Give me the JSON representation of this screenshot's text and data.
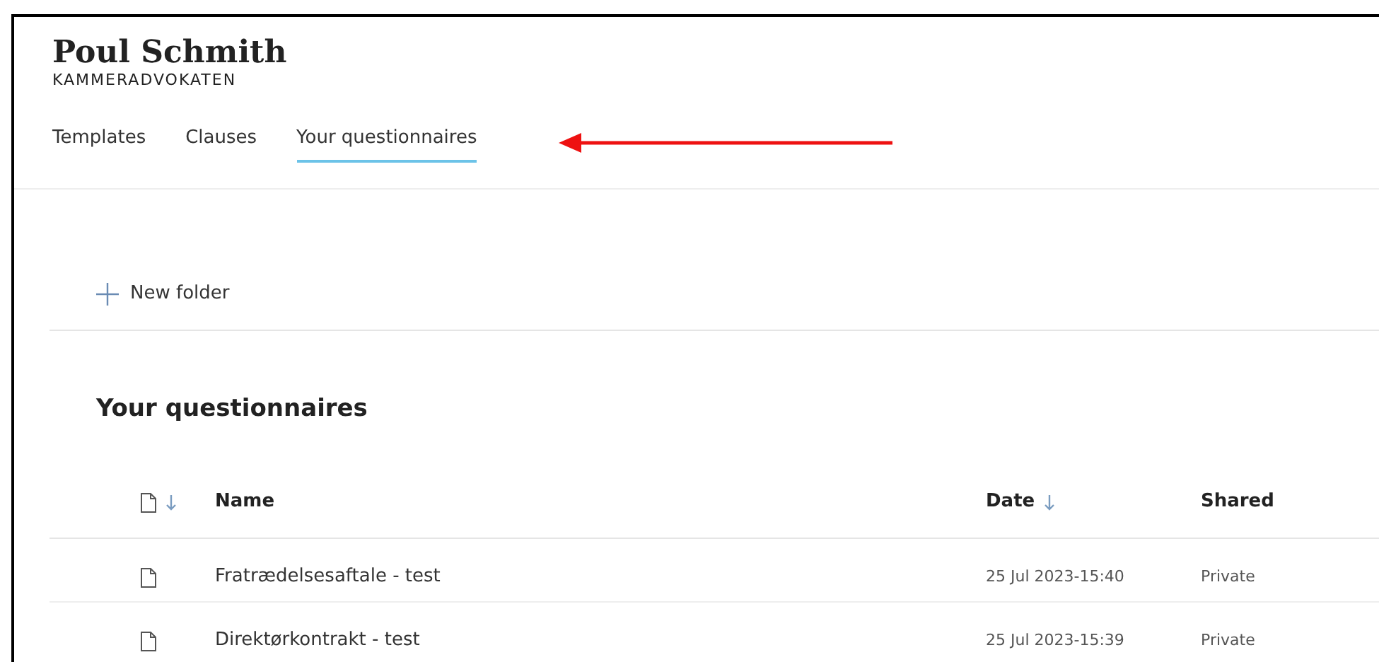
{
  "logo": {
    "name": "Poul Schmith",
    "subtitle": "KAMMERADVOKATEN"
  },
  "tabs": [
    {
      "label": "Templates",
      "selected": false
    },
    {
      "label": "Clauses",
      "selected": false
    },
    {
      "label": "Your questionnaires",
      "selected": true
    }
  ],
  "new_folder": {
    "label": "New folder"
  },
  "section_title": "Your questionnaires",
  "table": {
    "columns": [
      {
        "label": "Name",
        "sort_arrow": false
      },
      {
        "label": "Date",
        "sort_arrow": true
      },
      {
        "label": "Shared",
        "sort_arrow": false
      }
    ],
    "rows": [
      {
        "name": "Fratrædelsesaftale - test",
        "date": "25 Jul 2023-15:40",
        "shared": "Private"
      },
      {
        "name": "Direktørkontrakt - test",
        "date": "25 Jul 2023-15:39",
        "shared": "Private"
      }
    ]
  }
}
